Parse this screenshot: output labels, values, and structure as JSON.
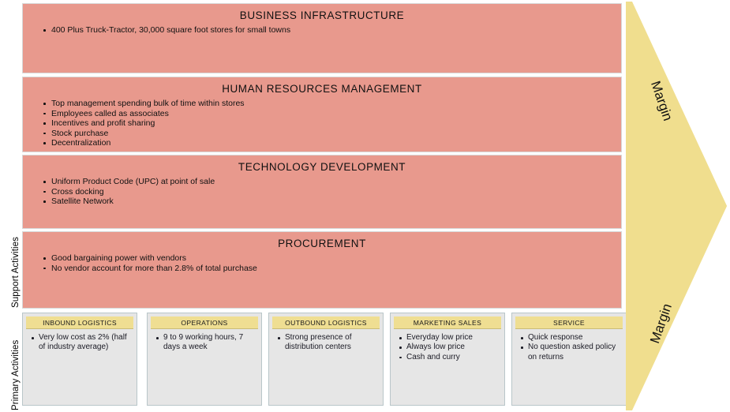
{
  "axis": {
    "support_label": "Support Activities",
    "primary_label": "Primary Activities"
  },
  "colors": {
    "support_band": "#E8998D",
    "margin_arrow": "#F0DE8E",
    "primary_header": "#EFDE92",
    "primary_body": "#E6E6E6"
  },
  "support_activities": [
    {
      "title": "BUSINESS INFRASTRUCTURE",
      "items": [
        "400 Plus Truck-Tractor, 30,000 square foot stores for small towns"
      ]
    },
    {
      "title": "HUMAN RESOURCES MANAGEMENT",
      "items": [
        "Top management spending bulk of time within stores",
        "Employees called as associates",
        "Incentives and profit sharing",
        "Stock purchase",
        "Decentralization"
      ]
    },
    {
      "title": "TECHNOLOGY DEVELOPMENT",
      "items": [
        "Uniform Product Code (UPC) at point of sale",
        "Cross docking",
        "Satellite Network"
      ]
    },
    {
      "title": "PROCUREMENT",
      "items": [
        "Good bargaining power with vendors",
        "No vendor account for more than 2.8% of total purchase"
      ]
    }
  ],
  "primary_activities": [
    {
      "title": "INBOUND LOGISTICS",
      "items": [
        "Very low cost as 2% (half of industry average)"
      ]
    },
    {
      "title": "OPERATIONS",
      "items": [
        "9 to 9 working hours, 7 days a week"
      ]
    },
    {
      "title": "OUTBOUND LOGISTICS",
      "items": [
        "Strong presence of distribution centers"
      ]
    },
    {
      "title": "MARKETING SALES",
      "items": [
        "Everyday low price",
        "Always low price",
        "Cash and curry"
      ]
    },
    {
      "title": "SERVICE",
      "items": [
        "Quick response",
        "No question asked policy on returns"
      ]
    }
  ],
  "margin": {
    "top_label": "Margin",
    "bottom_label": "Margin"
  }
}
